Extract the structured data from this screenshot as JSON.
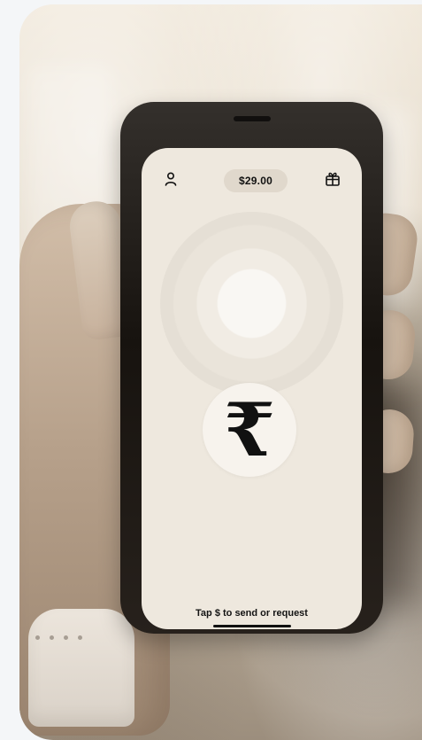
{
  "top_bar": {
    "profile_icon": "profile-icon",
    "balance": "$29.00",
    "gift_icon": "gift-icon"
  },
  "main": {
    "currency_symbol": "₹",
    "hint": "Tap $ to send or request"
  },
  "colors": {
    "screen_bg": "#eee8de",
    "pill_bg": "#e0d8cc",
    "phone_body": "#17130f",
    "text_dark": "#111111",
    "backdrop": "#ddd1be"
  }
}
